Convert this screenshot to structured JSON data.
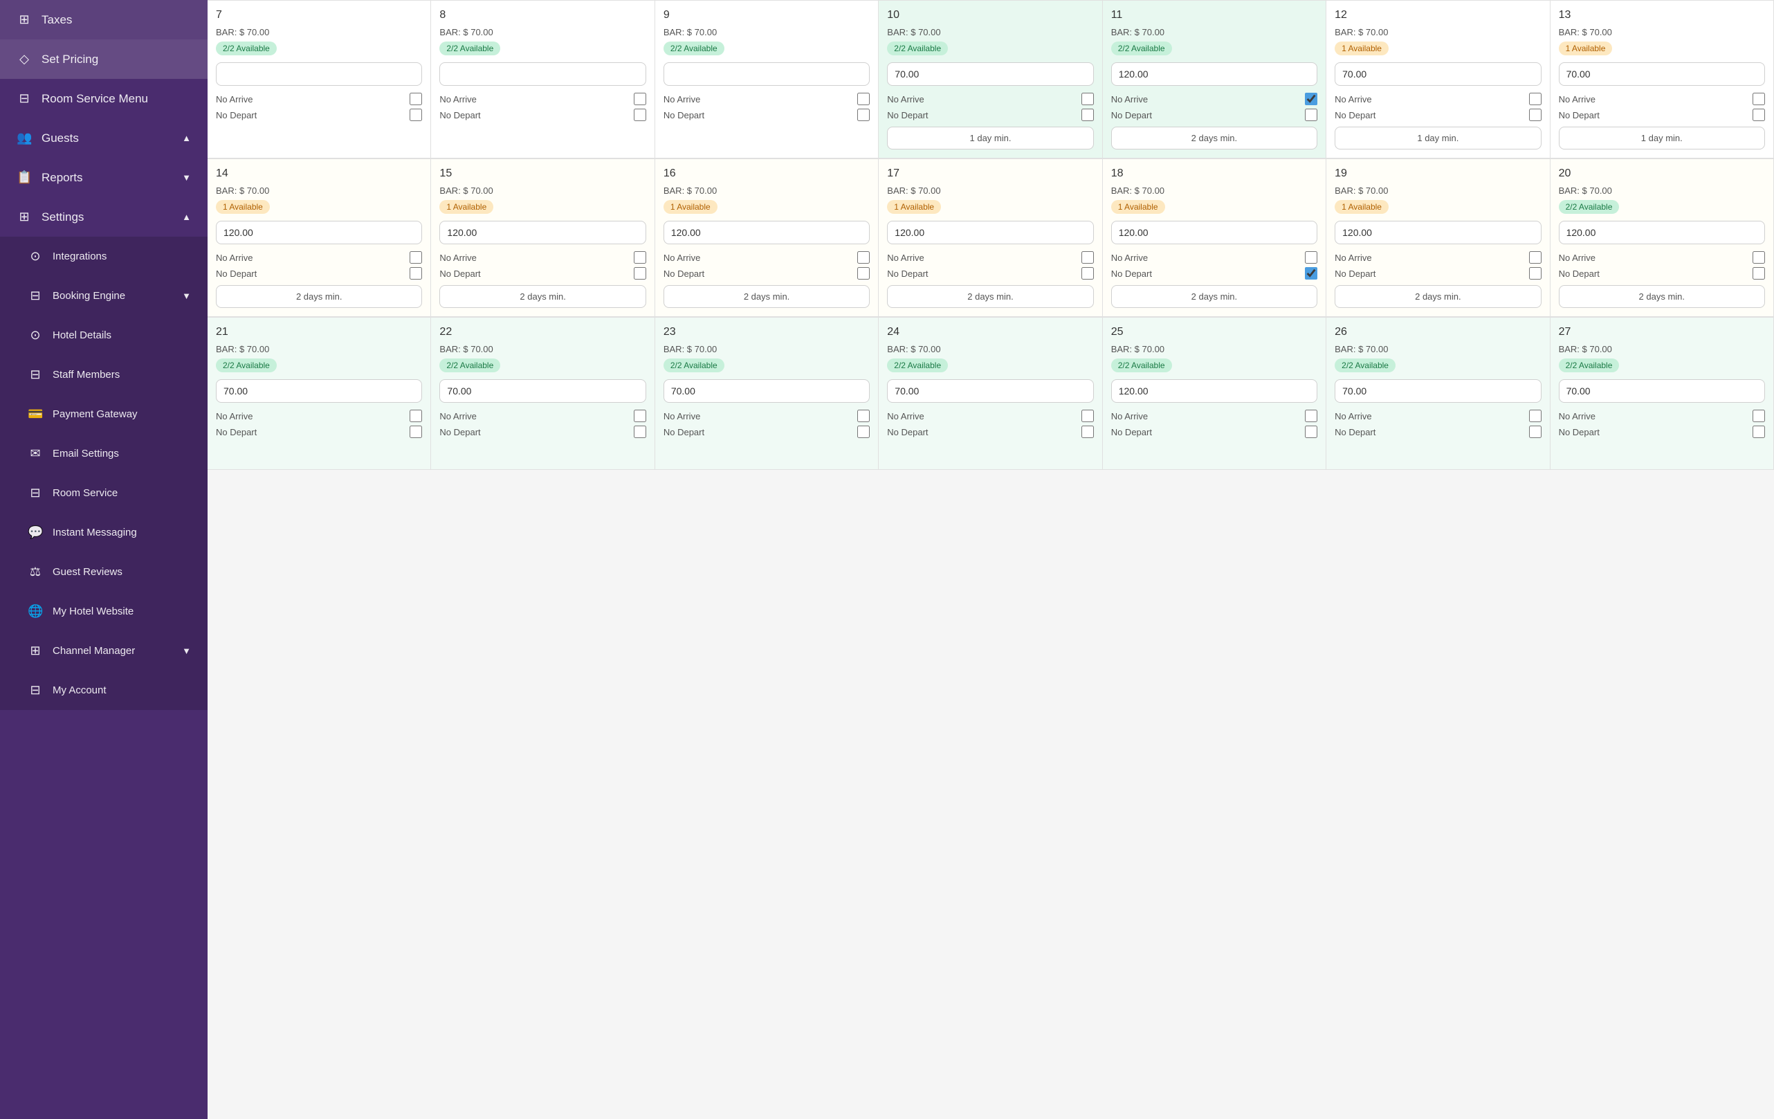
{
  "sidebar": {
    "items": [
      {
        "label": "Taxes",
        "icon": "⊞",
        "sub": false
      },
      {
        "label": "Set Pricing",
        "icon": "◇",
        "sub": false,
        "active": true
      },
      {
        "label": "Room Service Menu",
        "icon": "⊟",
        "sub": false
      },
      {
        "label": "Guests",
        "icon": "👥",
        "sub": true,
        "chevron": "▲"
      },
      {
        "label": "Reports",
        "icon": "📋",
        "sub": true,
        "chevron": "▼"
      },
      {
        "label": "Settings",
        "icon": "⊞",
        "sub": true,
        "chevron": "▲"
      }
    ],
    "settings_sub": [
      {
        "label": "Integrations",
        "icon": "⊙"
      },
      {
        "label": "Booking Engine",
        "icon": "⊟",
        "chevron": "▼"
      },
      {
        "label": "Hotel Details",
        "icon": "⊙"
      },
      {
        "label": "Staff Members",
        "icon": "⊟"
      },
      {
        "label": "Payment Gateway",
        "icon": "💳"
      },
      {
        "label": "Email Settings",
        "icon": "✉"
      },
      {
        "label": "Room Service",
        "icon": "⊟"
      },
      {
        "label": "Instant Messaging",
        "icon": "💬"
      },
      {
        "label": "Guest Reviews",
        "icon": "⚖"
      },
      {
        "label": "My Hotel Website",
        "icon": "🌐"
      },
      {
        "label": "Channel Manager",
        "icon": "⊞",
        "chevron": "▼"
      },
      {
        "label": "My Account",
        "icon": "⊟"
      }
    ]
  },
  "weeks": [
    {
      "days": [
        {
          "num": "7",
          "bar": "BAR: $ 70.00",
          "avail": "2/2 Available",
          "availType": "green",
          "price": "",
          "noArrive": false,
          "noDepart": false,
          "minDays": ""
        },
        {
          "num": "8",
          "bar": "BAR: $ 70.00",
          "avail": "2/2 Available",
          "availType": "green",
          "price": "",
          "noArrive": false,
          "noDepart": false,
          "minDays": ""
        },
        {
          "num": "9",
          "bar": "BAR: $ 70.00",
          "avail": "2/2 Available",
          "availType": "green",
          "price": "",
          "noArrive": false,
          "noDepart": false,
          "minDays": ""
        },
        {
          "num": "10",
          "bar": "BAR: $ 70.00",
          "avail": "2/2 Available",
          "availType": "green",
          "price": "70.00",
          "noArrive": false,
          "noDepart": false,
          "minDays": "1 day min."
        },
        {
          "num": "11",
          "bar": "BAR: $ 70.00",
          "avail": "2/2 Available",
          "availType": "green",
          "price": "120.00",
          "noArrive": true,
          "noDepart": false,
          "minDays": "2 days min.",
          "bgGreen": true
        },
        {
          "num": "12",
          "bar": "BAR: $ 70.00",
          "avail": "1 Available",
          "availType": "orange",
          "price": "70.00",
          "noArrive": false,
          "noDepart": false,
          "minDays": "1 day min."
        },
        {
          "num": "13",
          "bar": "BAR: $ 70.00",
          "avail": "1 Available",
          "availType": "orange",
          "price": "70.00",
          "noArrive": false,
          "noDepart": false,
          "minDays": "1 day min."
        }
      ]
    },
    {
      "days": [
        {
          "num": "14",
          "bar": "BAR: $ 70.00",
          "avail": "1 Available",
          "availType": "orange",
          "price": "120.00",
          "noArrive": false,
          "noDepart": false,
          "minDays": "2 days min."
        },
        {
          "num": "15",
          "bar": "BAR: $ 70.00",
          "avail": "1 Available",
          "availType": "orange",
          "price": "120.00",
          "noArrive": false,
          "noDepart": false,
          "minDays": "2 days min."
        },
        {
          "num": "16",
          "bar": "BAR: $ 70.00",
          "avail": "1 Available",
          "availType": "orange",
          "price": "120.00",
          "noArrive": false,
          "noDepart": false,
          "minDays": "2 days min."
        },
        {
          "num": "17",
          "bar": "BAR: $ 70.00",
          "avail": "1 Available",
          "availType": "orange",
          "price": "120.00",
          "noArrive": false,
          "noDepart": false,
          "minDays": "2 days min."
        },
        {
          "num": "18",
          "bar": "BAR: $ 70.00",
          "avail": "1 Available",
          "availType": "orange",
          "price": "120.00",
          "noArrive": false,
          "noDepart": true,
          "minDays": "2 days min."
        },
        {
          "num": "19",
          "bar": "BAR: $ 70.00",
          "avail": "1 Available",
          "availType": "orange",
          "price": "120.00",
          "noArrive": false,
          "noDepart": false,
          "minDays": "2 days min."
        },
        {
          "num": "20",
          "bar": "BAR: $ 70.00",
          "avail": "2/2 Available",
          "availType": "green",
          "price": "120.00",
          "noArrive": false,
          "noDepart": false,
          "minDays": "2 days min."
        }
      ]
    },
    {
      "days": [
        {
          "num": "21",
          "bar": "BAR: $ 70.00",
          "avail": "2/2 Available",
          "availType": "green",
          "price": "70.00",
          "noArrive": false,
          "noDepart": false,
          "minDays": ""
        },
        {
          "num": "22",
          "bar": "BAR: $ 70.00",
          "avail": "2/2 Available",
          "availType": "green",
          "price": "70.00",
          "noArrive": false,
          "noDepart": false,
          "minDays": ""
        },
        {
          "num": "23",
          "bar": "BAR: $ 70.00",
          "avail": "2/2 Available",
          "availType": "green",
          "price": "70.00",
          "noArrive": false,
          "noDepart": false,
          "minDays": ""
        },
        {
          "num": "24",
          "bar": "BAR: $ 70.00",
          "avail": "2/2 Available",
          "availType": "green",
          "price": "70.00",
          "noArrive": false,
          "noDepart": false,
          "minDays": ""
        },
        {
          "num": "25",
          "bar": "BAR: $ 70.00",
          "avail": "2/2 Available",
          "availType": "green",
          "price": "120.00",
          "noArrive": false,
          "noDepart": false,
          "minDays": ""
        },
        {
          "num": "26",
          "bar": "BAR: $ 70.00",
          "avail": "2/2 Available",
          "availType": "green",
          "price": "70.00",
          "noArrive": false,
          "noDepart": false,
          "minDays": ""
        },
        {
          "num": "27",
          "bar": "BAR: $ 70.00",
          "avail": "2/2 Available",
          "availType": "green",
          "price": "70.00",
          "noArrive": false,
          "noDepart": false,
          "minDays": ""
        }
      ]
    }
  ],
  "labels": {
    "no_arrive": "No Arrive",
    "no_depart": "No Depart"
  }
}
